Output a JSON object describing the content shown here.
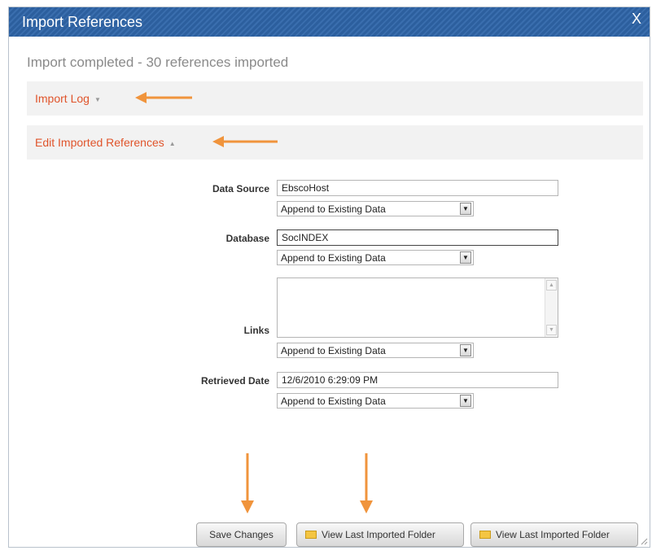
{
  "dialog": {
    "title": "Import References",
    "close_label": "X",
    "status_text": "Import completed - 30 references imported"
  },
  "sections": {
    "import_log": {
      "label": "Import Log",
      "caret": "▼"
    },
    "edit_refs": {
      "label": "Edit Imported References",
      "caret": "▲"
    }
  },
  "form": {
    "data_source": {
      "label": "Data Source",
      "value": "EbscoHost",
      "mode": "Append to Existing Data"
    },
    "database": {
      "label": "Database",
      "value": "SocINDEX",
      "mode": "Append to Existing Data"
    },
    "links": {
      "label": "Links",
      "value": "",
      "mode": "Append to Existing Data"
    },
    "retrieved_date": {
      "label": "Retrieved Date",
      "value": "12/6/2010 6:29:09 PM",
      "mode": "Append to Existing Data"
    }
  },
  "buttons": {
    "save": "Save Changes",
    "view_last_1": "View Last Imported Folder",
    "view_last_2": "View Last Imported Folder"
  },
  "colors": {
    "title_bar": "#2c5f9e",
    "section_link": "#e0542b",
    "annotation_arrow": "#f0943c"
  },
  "icons": {
    "dropdown": "chevron-down-icon",
    "folder": "folder-icon",
    "close": "close-icon"
  }
}
